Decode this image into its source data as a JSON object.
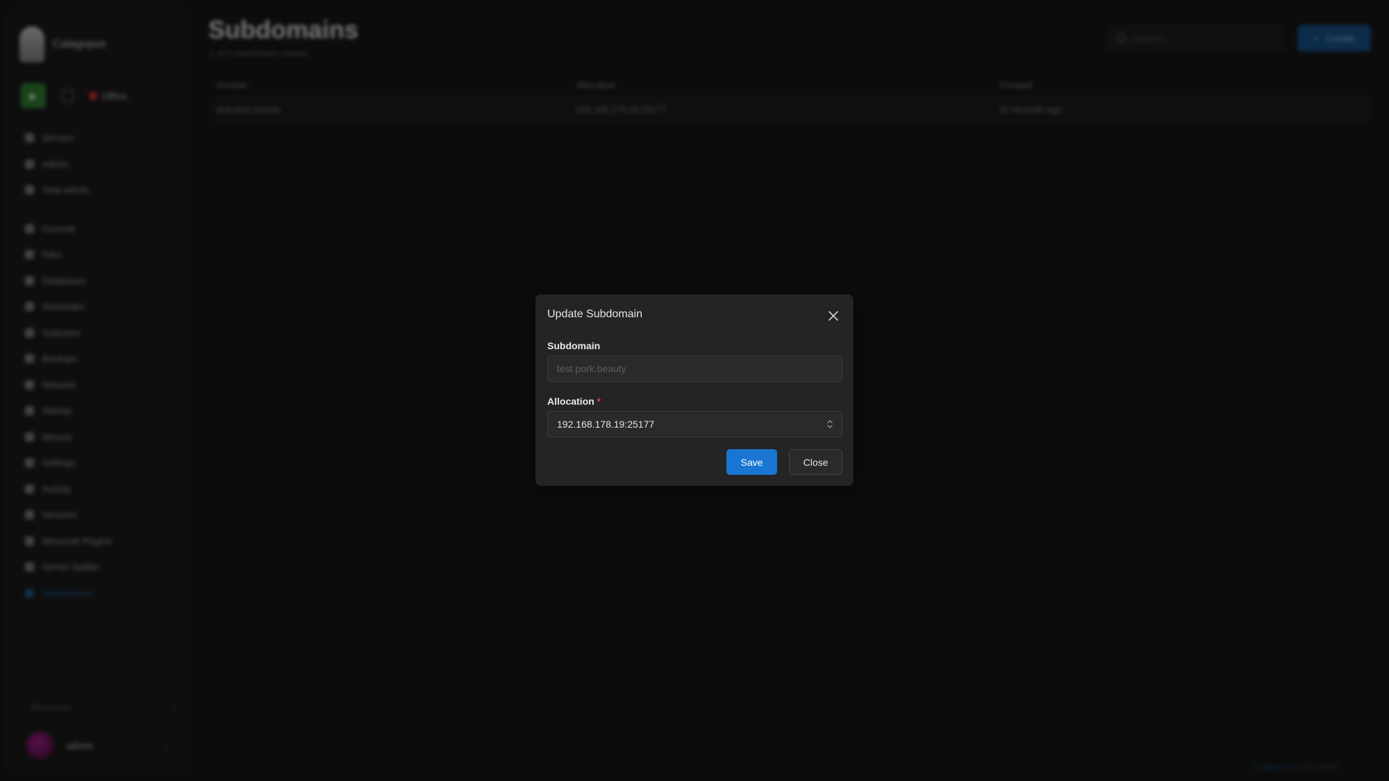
{
  "app": {
    "brand_name": "Calagopus",
    "server_status": "Offline",
    "nav_group_1": [
      "Servers",
      "Admin",
      "View admin"
    ],
    "nav_group_2": [
      "Console",
      "Files",
      "Databases",
      "Schedules",
      "Subusers",
      "Backups",
      "Network",
      "Startup",
      "Mounts",
      "Settings",
      "Activity",
      "Versions",
      "Minecraft Plugins",
      "Server Splitter",
      "Subdomains"
    ],
    "active_nav": "Subdomains",
    "resources_label": "Resources",
    "user_name": "admin"
  },
  "page": {
    "title": "Subdomains",
    "subtitle": "1 of 3 subdomains created",
    "search_placeholder": "Search...",
    "create_label": "Create"
  },
  "table": {
    "headers": [
      "Domain",
      "Allocation",
      "Created"
    ],
    "rows": [
      {
        "domain": "test.pork.beauty",
        "allocation": "192.168.178.19:25177",
        "created": "16 seconds ago"
      }
    ]
  },
  "footer": {
    "link": "Calagopus",
    "version": "1.0.0 (2fb0)"
  },
  "modal": {
    "title": "Update Subdomain",
    "subdomain_label": "Subdomain",
    "subdomain_placeholder": "test.pork.beauty",
    "allocation_label": "Allocation",
    "required_mark": "*",
    "allocation_value": "192.168.178.19:25177",
    "save_label": "Save",
    "close_label": "Close"
  }
}
